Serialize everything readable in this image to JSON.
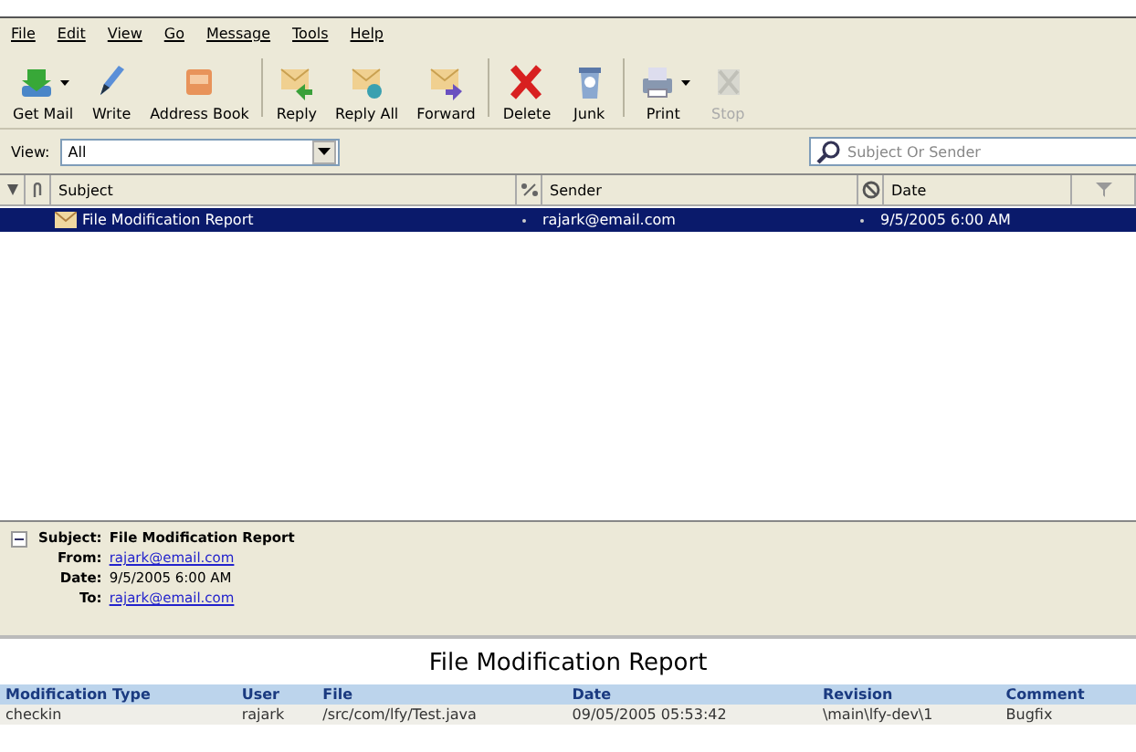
{
  "menu": [
    "File",
    "Edit",
    "View",
    "Go",
    "Message",
    "Tools",
    "Help"
  ],
  "toolbar_groups": [
    {
      "buttons": [
        {
          "label": "Get Mail",
          "dropdown": true,
          "disabled": false
        },
        {
          "label": "Write",
          "dropdown": false,
          "disabled": false
        },
        {
          "label": "Address Book",
          "dropdown": false,
          "disabled": false
        }
      ]
    },
    {
      "buttons": [
        {
          "label": "Reply",
          "dropdown": false,
          "disabled": false
        },
        {
          "label": "Reply All",
          "dropdown": false,
          "disabled": false
        },
        {
          "label": "Forward",
          "dropdown": false,
          "disabled": false
        }
      ]
    },
    {
      "buttons": [
        {
          "label": "Delete",
          "dropdown": false,
          "disabled": false
        },
        {
          "label": "Junk",
          "dropdown": false,
          "disabled": false
        }
      ]
    },
    {
      "buttons": [
        {
          "label": "Print",
          "dropdown": true,
          "disabled": false
        },
        {
          "label": "Stop",
          "dropdown": false,
          "disabled": true
        }
      ]
    }
  ],
  "view": {
    "label": "View:",
    "value": "All"
  },
  "search": {
    "placeholder": "Subject Or Sender"
  },
  "thread_columns": {
    "subject": "Subject",
    "sender": "Sender",
    "date": "Date"
  },
  "messages": [
    {
      "subject": "File Modification Report",
      "sender": "rajark@email.com",
      "date": "9/5/2005 6:00 AM",
      "selected": true
    }
  ],
  "header": {
    "fields": [
      {
        "label": "Subject:",
        "value": "File Modification Report",
        "kind": "bold"
      },
      {
        "label": "From:",
        "value": "rajark@email.com",
        "kind": "link"
      },
      {
        "label": "Date:",
        "value": "9/5/2005 6:00 AM",
        "kind": "plain"
      },
      {
        "label": "To:",
        "value": "rajark@email.com",
        "kind": "link"
      }
    ]
  },
  "report": {
    "title": "File Modification Report",
    "columns": [
      "Modification Type",
      "User",
      "File",
      "Date",
      "Revision",
      "Comment"
    ],
    "rows": [
      [
        "checkin",
        "rajark",
        "/src/com/lfy/Test.java",
        "09/05/2005 05:53:42",
        "\\main\\lfy-dev\\1",
        "Bugfix"
      ]
    ]
  }
}
